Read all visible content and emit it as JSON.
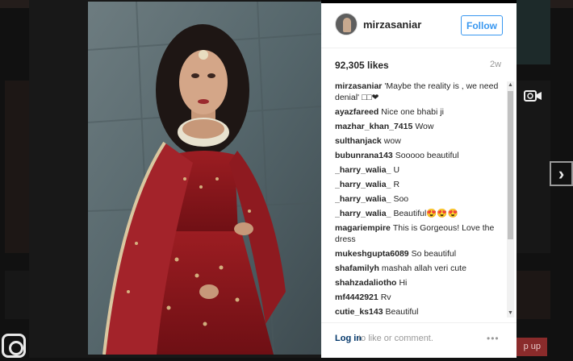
{
  "post": {
    "username": "mirzasaniar",
    "follow_label": "Follow",
    "likes": "92,305 likes",
    "age": "2w"
  },
  "comments": [
    {
      "author": "mirzasaniar",
      "text": "'Maybe the reality is , we need denial' □□❤"
    },
    {
      "author": "ayazfareed",
      "text": "Nice one bhabi ji"
    },
    {
      "author": "mazhar_khan_7415",
      "text": "Wow"
    },
    {
      "author": "sulthanjack",
      "text": "wow"
    },
    {
      "author": "bubunrana143",
      "text": "Sooooo beautiful"
    },
    {
      "author": "_harry_walia_",
      "text": "U"
    },
    {
      "author": "_harry_walia_",
      "text": "R"
    },
    {
      "author": "_harry_walia_",
      "text": "Soo"
    },
    {
      "author": "_harry_walia_",
      "text": "Beautiful😍😍😍"
    },
    {
      "author": "magariempire",
      "text": "This is Gorgeous! Love the dress"
    },
    {
      "author": "mukeshgupta6089",
      "text": "So beautiful"
    },
    {
      "author": "shafamilyh",
      "text": "mashah allah veri cute"
    },
    {
      "author": "shahzadaliotho",
      "text": "Hi"
    },
    {
      "author": "mf4442921",
      "text": "Rv"
    },
    {
      "author": "cutie_ks143",
      "text": "Beautiful"
    }
  ],
  "footer": {
    "login_label": "Log in",
    "login_rest": "to like or comment.",
    "more_label": "•••"
  },
  "background": {
    "signup_label": "p up"
  },
  "colors": {
    "accent": "#3897f0",
    "link": "#003569",
    "scroll_track": "#f1f1f1",
    "scroll_thumb": "#c1c1c1"
  },
  "icons": [
    "next-arrow-icon",
    "video-camera-icon",
    "instagram-logo-icon",
    "scroll-up-icon",
    "scroll-down-icon",
    "more-options-icon"
  ]
}
